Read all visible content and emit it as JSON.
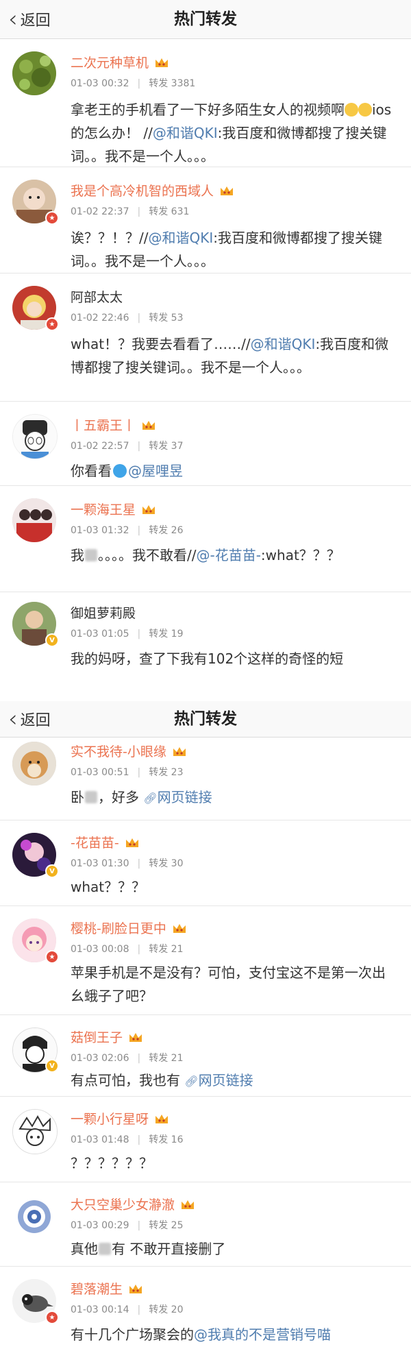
{
  "header": {
    "back_label": "返回",
    "title": "热门转发"
  },
  "icons": {
    "verified_red": "#e34a3a",
    "verified_gold": "#f2b21d",
    "name_orange": "#eb7350",
    "link_blue": "#507daf"
  },
  "screen1": {
    "items": [
      {
        "name": "二次元种草机",
        "time": "01-03 00:32",
        "repost_label": "转发",
        "repost_count": "3381",
        "text_a": "拿老王的手机看了一下好多陌生女人的视频啊",
        "text_b": "ios的怎么办！ //",
        "mention": "@和谐QKI",
        "text_c": ":我百度和微博都搜了搜关键词。。我不是一个人。。。"
      },
      {
        "name": "我是个高冷机智的西域人",
        "time": "01-02 22:37",
        "repost_label": "转发",
        "repost_count": "631",
        "text_a": "诶？？！？//",
        "mention": "@和谐QKI",
        "text_b": ":我百度和微博都搜了搜关键词。。我不是一个人。。。"
      },
      {
        "name": "阿部太太",
        "time": "01-02 22:46",
        "repost_label": "转发",
        "repost_count": "53",
        "text_a": "what！？我要去看看了……//",
        "mention": "@和谐QKI",
        "text_b": ":我百度和微博都搜了搜关键词。。我不是一个人。。。"
      },
      {
        "name": "丨五霸王丨",
        "time": "01-02 22:57",
        "repost_label": "转发",
        "repost_count": "37",
        "text_a": "你看看",
        "mention": "@屋哩昱"
      },
      {
        "name": "一颗海王星",
        "time": "01-03 01:32",
        "repost_label": "转发",
        "repost_count": "26",
        "text_a": "我",
        "text_b": "。。。。我不敢看//",
        "mention": "@-花苗苗-",
        "text_c": ":what？？？"
      },
      {
        "name": "御姐萝莉殿",
        "time": "01-03 01:05",
        "repost_label": "转发",
        "repost_count": "19",
        "text_a": "我的妈呀，查了下我有102个这样的奇怪的短"
      }
    ]
  },
  "screen2": {
    "items": [
      {
        "name": "实不我待-小眼缘",
        "time": "01-03 00:51",
        "repost_label": "转发",
        "repost_count": "23",
        "text_a": "卧",
        "text_b": "，好多",
        "link": "网页链接"
      },
      {
        "name": "-花苗苗-",
        "time": "01-03 01:30",
        "repost_label": "转发",
        "repost_count": "30",
        "text_a": "what？？？"
      },
      {
        "name": "樱桃-刷脸日更中",
        "time": "01-03 00:08",
        "repost_label": "转发",
        "repost_count": "21",
        "text_a": "苹果手机是不是没有？可怕，支付宝这不是第一次出幺蛾子了吧？"
      },
      {
        "name": "菇倒王子",
        "time": "01-03 02:06",
        "repost_label": "转发",
        "repost_count": "21",
        "text_a": "有点可怕，我也有",
        "link": "网页链接"
      },
      {
        "name": "一颗小行星呀",
        "time": "01-03 01:48",
        "repost_label": "转发",
        "repost_count": "16",
        "text_a": "？？？？？？"
      },
      {
        "name": "大只空巢少女瀞澈",
        "time": "01-03 00:29",
        "repost_label": "转发",
        "repost_count": "25",
        "text_a": "真他",
        "text_b": "有 不敢开直接删了"
      },
      {
        "name": "碧落潮生",
        "time": "01-03 00:14",
        "repost_label": "转发",
        "repost_count": "20",
        "text_a": "有十几个广场聚会的",
        "mention": "@我真的不是营销号喵"
      }
    ]
  }
}
